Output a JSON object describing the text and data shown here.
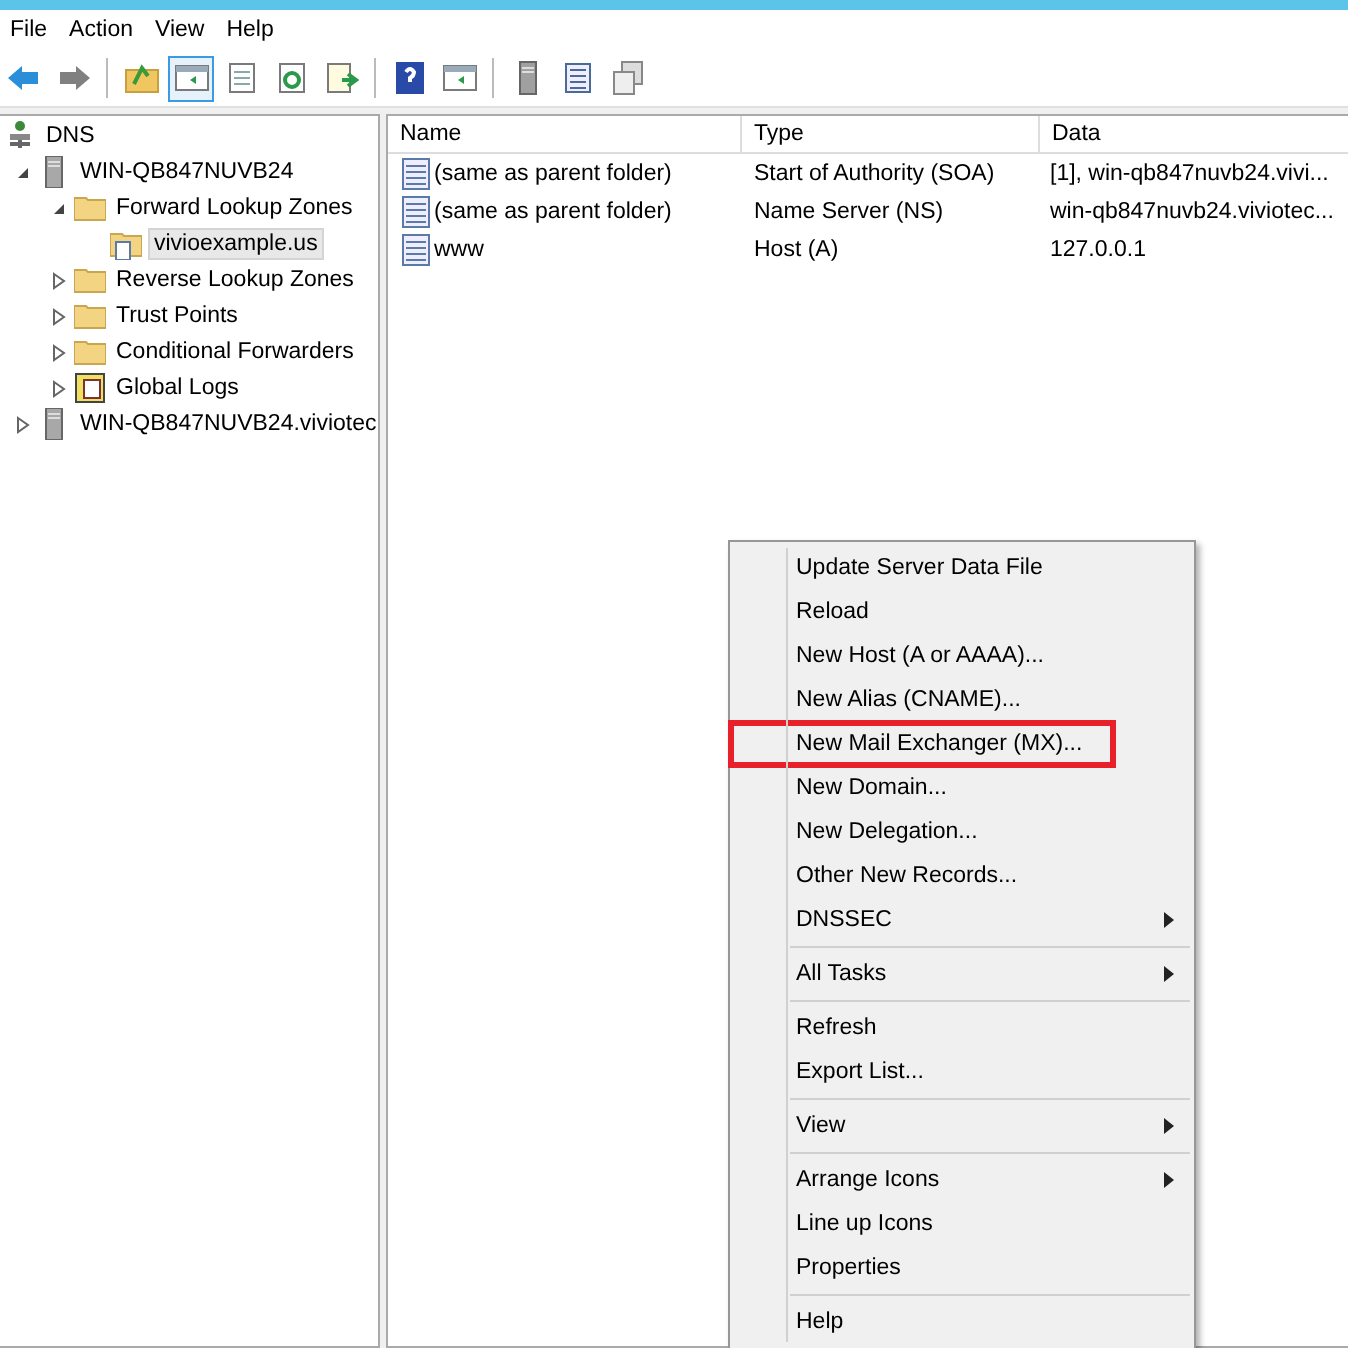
{
  "menu_bar": [
    "File",
    "Action",
    "View",
    "Help"
  ],
  "toolbar": [
    [
      {
        "kind": "back",
        "pressed": false
      },
      {
        "kind": "forward",
        "pressed": false
      }
    ],
    [
      {
        "kind": "up",
        "pressed": false
      },
      {
        "kind": "pane",
        "pressed": true
      },
      {
        "kind": "page",
        "pressed": false
      },
      {
        "kind": "refresh",
        "pressed": false
      },
      {
        "kind": "export",
        "pressed": false
      }
    ],
    [
      {
        "kind": "help",
        "pressed": false
      },
      {
        "kind": "pane",
        "pressed": false
      }
    ],
    [
      {
        "kind": "server",
        "pressed": false
      },
      {
        "kind": "list",
        "pressed": false
      },
      {
        "kind": "copy",
        "pressed": false
      }
    ]
  ],
  "tree": [
    {
      "label": "DNS",
      "kind": "dns",
      "selected": false,
      "children": [
        {
          "label": "WIN-QB847NUVB24",
          "kind": "server",
          "expanded": true,
          "selected": false,
          "children": [
            {
              "label": "Forward Lookup Zones",
              "kind": "folder",
              "expanded": true,
              "selected": false,
              "children": [
                {
                  "label": "vivioexample.us",
                  "kind": "zone",
                  "selected": true
                }
              ]
            },
            {
              "label": "Reverse Lookup Zones",
              "kind": "folder",
              "expanded": false,
              "selected": false
            },
            {
              "label": "Trust Points",
              "kind": "folder",
              "expanded": false,
              "selected": false
            },
            {
              "label": "Conditional Forwarders",
              "kind": "folder",
              "expanded": false,
              "selected": false
            },
            {
              "label": "Global Logs",
              "kind": "logs",
              "expanded": false,
              "selected": false
            }
          ]
        },
        {
          "label": "WIN-QB847NUVB24.viviotec",
          "kind": "server",
          "expanded": false,
          "selected": false
        }
      ]
    }
  ],
  "table": {
    "columns": [
      "Name",
      "Type",
      "Data"
    ],
    "rows": [
      [
        "(same as parent folder)",
        "Start of Authority (SOA)",
        "[1], win-qb847nuvb24.vivi..."
      ],
      [
        "(same as parent folder)",
        "Name Server (NS)",
        "win-qb847nuvb24.viviotec..."
      ],
      [
        "www",
        "Host (A)",
        "127.0.0.1"
      ]
    ]
  },
  "context_menu": [
    [
      {
        "label": "Update Server Data File",
        "submenu": false,
        "highlighted": false
      },
      {
        "label": "Reload",
        "submenu": false,
        "highlighted": false
      },
      {
        "label": "New Host (A or AAAA)...",
        "submenu": false,
        "highlighted": false
      },
      {
        "label": "New Alias (CNAME)...",
        "submenu": false,
        "highlighted": false
      },
      {
        "label": "New Mail Exchanger (MX)...",
        "submenu": false,
        "highlighted": true
      },
      {
        "label": "New Domain...",
        "submenu": false,
        "highlighted": false
      },
      {
        "label": "New Delegation...",
        "submenu": false,
        "highlighted": false
      },
      {
        "label": "Other New Records...",
        "submenu": false,
        "highlighted": false
      },
      {
        "label": "DNSSEC",
        "submenu": true,
        "highlighted": false
      }
    ],
    [
      {
        "label": "All Tasks",
        "submenu": true,
        "highlighted": false
      }
    ],
    [
      {
        "label": "Refresh",
        "submenu": false,
        "highlighted": false
      },
      {
        "label": "Export List...",
        "submenu": false,
        "highlighted": false
      }
    ],
    [
      {
        "label": "View",
        "submenu": true,
        "highlighted": false
      }
    ],
    [
      {
        "label": "Arrange Icons",
        "submenu": true,
        "highlighted": false
      },
      {
        "label": "Line up Icons",
        "submenu": false,
        "highlighted": false
      },
      {
        "label": "Properties",
        "submenu": false,
        "highlighted": false
      }
    ],
    [
      {
        "label": "Help",
        "submenu": false,
        "highlighted": false
      }
    ]
  ]
}
